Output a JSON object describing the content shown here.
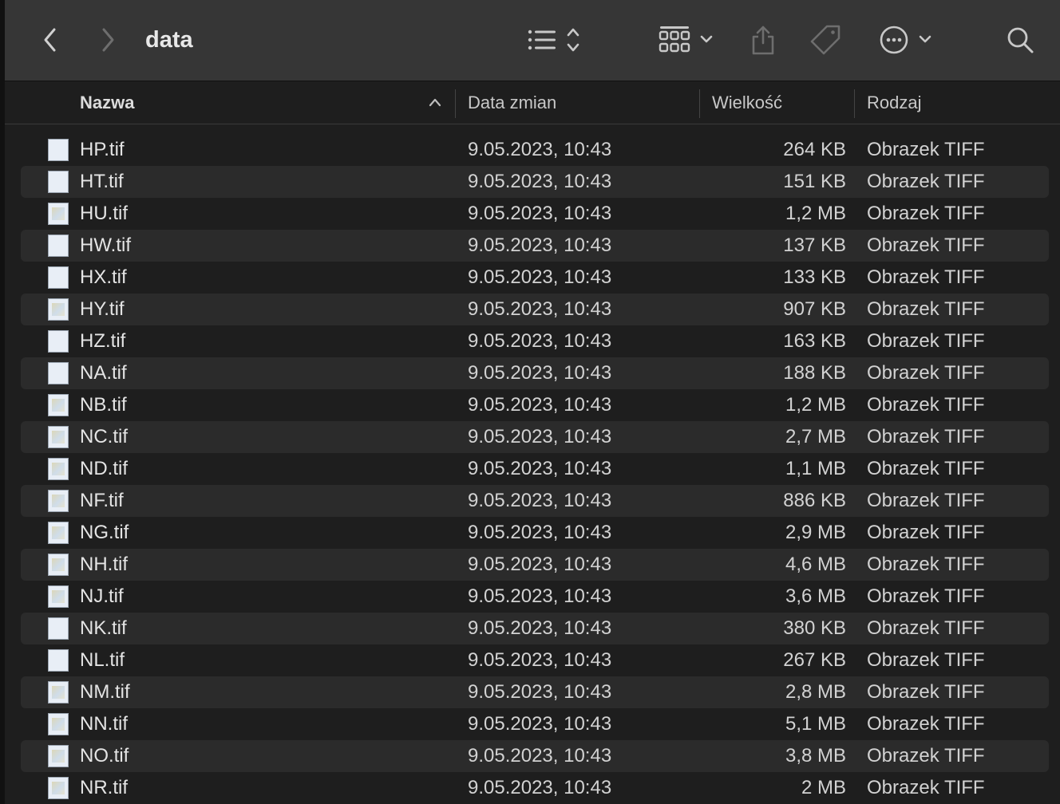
{
  "window": {
    "title": "data"
  },
  "toolbar": {
    "icons": [
      "chevron-left-icon",
      "chevron-right-icon",
      "list-view-icon",
      "group-grid-icon",
      "share-icon",
      "tag-icon",
      "more-icon",
      "search-icon"
    ]
  },
  "columns": {
    "name": "Nazwa",
    "date": "Data zmian",
    "size": "Wielkość",
    "kind": "Rodzaj"
  },
  "files": [
    {
      "name": "HP.tif",
      "date": "9.05.2023, 10:43",
      "size": "264 KB",
      "kind": "Obrazek TIFF"
    },
    {
      "name": "HT.tif",
      "date": "9.05.2023, 10:43",
      "size": "151 KB",
      "kind": "Obrazek TIFF"
    },
    {
      "name": "HU.tif",
      "date": "9.05.2023, 10:43",
      "size": "1,2 MB",
      "kind": "Obrazek TIFF"
    },
    {
      "name": "HW.tif",
      "date": "9.05.2023, 10:43",
      "size": "137 KB",
      "kind": "Obrazek TIFF"
    },
    {
      "name": "HX.tif",
      "date": "9.05.2023, 10:43",
      "size": "133 KB",
      "kind": "Obrazek TIFF"
    },
    {
      "name": "HY.tif",
      "date": "9.05.2023, 10:43",
      "size": "907 KB",
      "kind": "Obrazek TIFF"
    },
    {
      "name": "HZ.tif",
      "date": "9.05.2023, 10:43",
      "size": "163 KB",
      "kind": "Obrazek TIFF"
    },
    {
      "name": "NA.tif",
      "date": "9.05.2023, 10:43",
      "size": "188 KB",
      "kind": "Obrazek TIFF"
    },
    {
      "name": "NB.tif",
      "date": "9.05.2023, 10:43",
      "size": "1,2 MB",
      "kind": "Obrazek TIFF"
    },
    {
      "name": "NC.tif",
      "date": "9.05.2023, 10:43",
      "size": "2,7 MB",
      "kind": "Obrazek TIFF"
    },
    {
      "name": "ND.tif",
      "date": "9.05.2023, 10:43",
      "size": "1,1 MB",
      "kind": "Obrazek TIFF"
    },
    {
      "name": "NF.tif",
      "date": "9.05.2023, 10:43",
      "size": "886 KB",
      "kind": "Obrazek TIFF"
    },
    {
      "name": "NG.tif",
      "date": "9.05.2023, 10:43",
      "size": "2,9 MB",
      "kind": "Obrazek TIFF"
    },
    {
      "name": "NH.tif",
      "date": "9.05.2023, 10:43",
      "size": "4,6 MB",
      "kind": "Obrazek TIFF"
    },
    {
      "name": "NJ.tif",
      "date": "9.05.2023, 10:43",
      "size": "3,6 MB",
      "kind": "Obrazek TIFF"
    },
    {
      "name": "NK.tif",
      "date": "9.05.2023, 10:43",
      "size": "380 KB",
      "kind": "Obrazek TIFF"
    },
    {
      "name": "NL.tif",
      "date": "9.05.2023, 10:43",
      "size": "267 KB",
      "kind": "Obrazek TIFF"
    },
    {
      "name": "NM.tif",
      "date": "9.05.2023, 10:43",
      "size": "2,8 MB",
      "kind": "Obrazek TIFF"
    },
    {
      "name": "NN.tif",
      "date": "9.05.2023, 10:43",
      "size": "5,1 MB",
      "kind": "Obrazek TIFF"
    },
    {
      "name": "NO.tif",
      "date": "9.05.2023, 10:43",
      "size": "3,8 MB",
      "kind": "Obrazek TIFF"
    },
    {
      "name": "NR.tif",
      "date": "9.05.2023, 10:43",
      "size": "2 MB",
      "kind": "Obrazek TIFF"
    }
  ]
}
